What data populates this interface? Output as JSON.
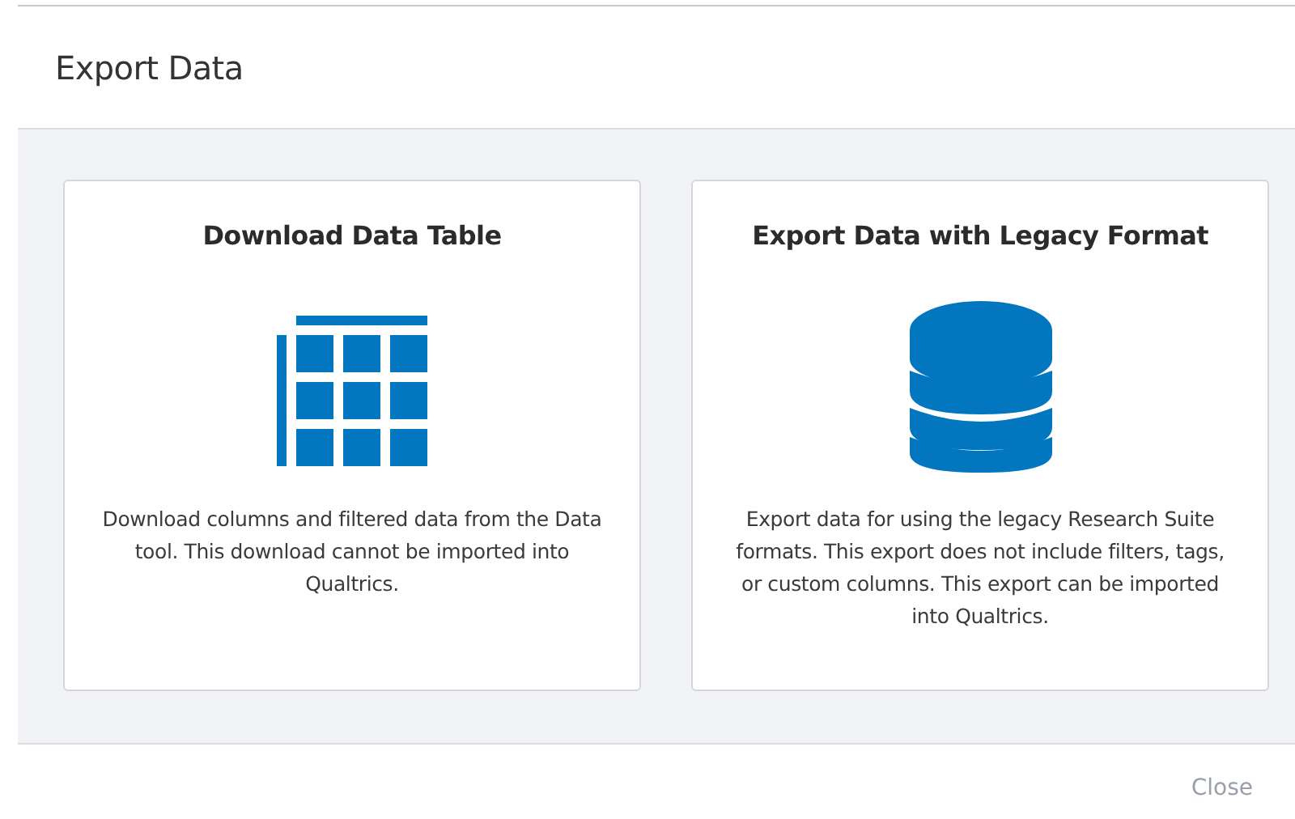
{
  "dialog": {
    "title": "Export Data",
    "options": [
      {
        "kind": "table",
        "title": "Download Data Table",
        "description": "Download columns and filtered data from the Data tool. This download cannot be imported into Qualtrics."
      },
      {
        "kind": "database",
        "title": "Export Data with Legacy Format",
        "description": "Export data for using the legacy Research Suite formats. This export does not include filters, tags, or custom columns. This export can be imported into Qualtrics."
      }
    ],
    "buttons": [
      "Close"
    ]
  }
}
